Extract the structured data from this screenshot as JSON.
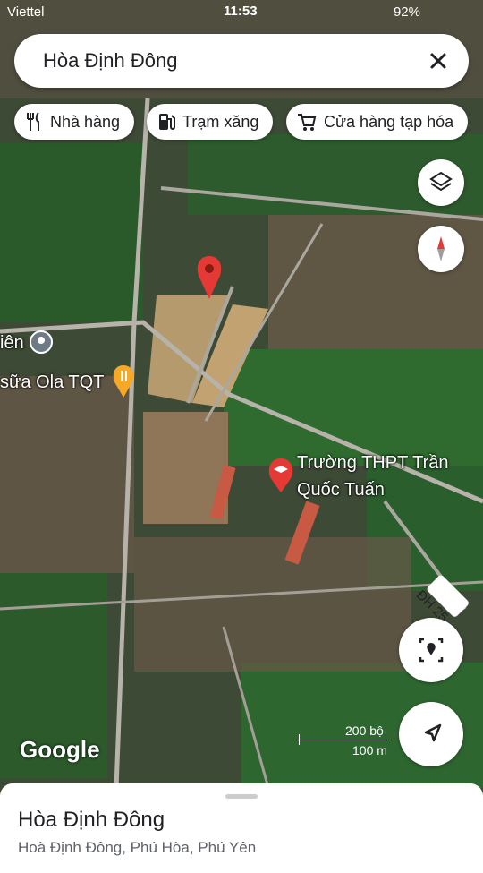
{
  "status": {
    "carrier": "Viettel",
    "time": "11:53",
    "battery": "92%"
  },
  "search": {
    "query": "Hòa Định Đông"
  },
  "chips": [
    {
      "label": "Nhà hàng",
      "icon": "restaurant-icon"
    },
    {
      "label": "Trạm xăng",
      "icon": "gas-station-icon"
    },
    {
      "label": "Cửa hàng tạp hóa",
      "icon": "shopping-cart-icon"
    }
  ],
  "map": {
    "labels": {
      "edge_label": "iên",
      "cafe": "sữa Ola TQT",
      "school_line1": "Trường THPT Trần",
      "school_line2": "Quốc Tuấn",
      "road": "ĐH 25"
    },
    "scale": {
      "top": "200 bộ",
      "bottom": "100 m"
    },
    "brand": "Google"
  },
  "place": {
    "title": "Hòa Định Đông",
    "subtitle": "Hoà Định Đông, Phú Hòa, Phú Yên"
  },
  "colors": {
    "pin": "#e53935",
    "poi": "#f9a825",
    "school": "#e53935",
    "text": "#202124"
  }
}
